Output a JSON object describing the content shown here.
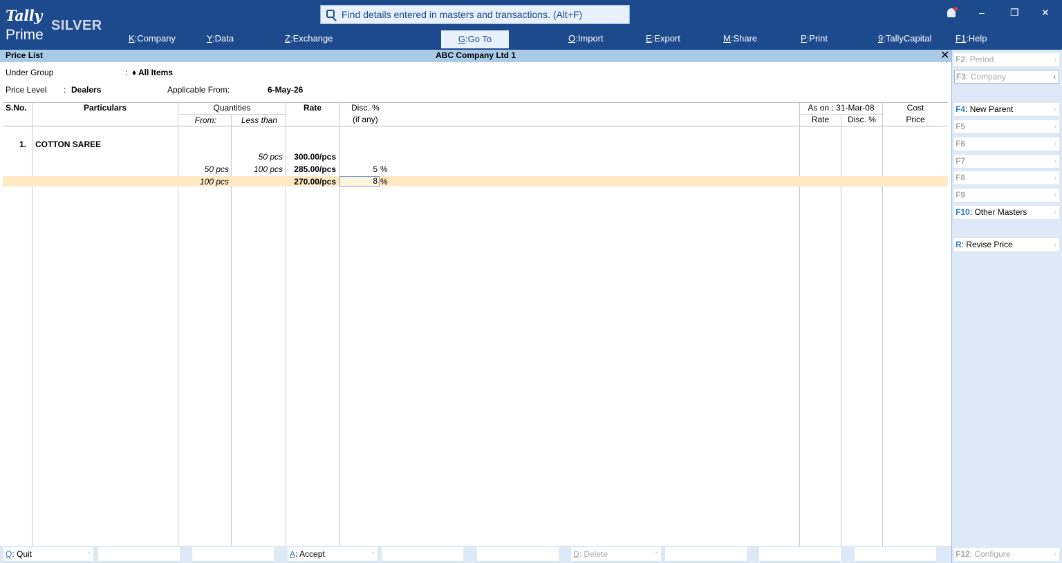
{
  "app": {
    "logo_top": "Tally",
    "logo_bottom": "Prime",
    "edition": "SILVER"
  },
  "search": {
    "text": "Find details entered in masters and transactions. (Alt+F)"
  },
  "window": {
    "minimize": "–",
    "restore": "❐",
    "close": "✕"
  },
  "menu": [
    {
      "key": "K",
      "label": "Company"
    },
    {
      "key": "Y",
      "label": "Data"
    },
    {
      "key": "Z",
      "label": "Exchange"
    },
    {
      "key": "G",
      "label": "Go To"
    },
    {
      "key": "O",
      "label": "Import"
    },
    {
      "key": "E",
      "label": "Export"
    },
    {
      "key": "M",
      "label": "Share"
    },
    {
      "key": "P",
      "label": "Print"
    },
    {
      "key": "9",
      "label": "TallyCapital"
    },
    {
      "key": "F1",
      "label": "Help"
    }
  ],
  "titlebar": {
    "screen": "Price List",
    "company": "ABC Company Ltd 1",
    "close": "✕"
  },
  "header": {
    "under_group_label": "Under Group",
    "under_group_sep": ":",
    "under_group_value": "♦ All Items",
    "price_level_label": "Price Level",
    "price_level_sep": ":",
    "price_level_value": "Dealers",
    "applicable_from_label": "Applicable From:",
    "applicable_from_value": "6-May-26"
  },
  "columns": {
    "sno": "S.No.",
    "particulars": "Particulars",
    "quantities": "Quantities",
    "from": "From:",
    "less_than": "Less than",
    "rate": "Rate",
    "disc": "Disc. %",
    "if_any": "(if any)",
    "as_on": "As on : 31-Mar-08",
    "as_on_rate": "Rate",
    "as_on_disc": "Disc. %",
    "cost": "Cost",
    "cost_price": "Price"
  },
  "item": {
    "sno": "1.",
    "name": "COTTON SAREE"
  },
  "slabs": [
    {
      "from": "",
      "less_than": "50 pcs",
      "rate": "300.00/pcs",
      "disc": "",
      "disc_unit": ""
    },
    {
      "from": "50 pcs",
      "less_than": "100 pcs",
      "rate": "285.00/pcs",
      "disc": "5",
      "disc_unit": "%"
    },
    {
      "from": "100 pcs",
      "less_than": "",
      "rate": "270.00/pcs",
      "disc": "8",
      "disc_unit": "%"
    }
  ],
  "right_panel": [
    {
      "key": "F2",
      "label": "Period",
      "enabled": false
    },
    {
      "key": "F3",
      "label": "Company",
      "enabled": false
    },
    {
      "key": "F4",
      "label": "New Parent",
      "enabled": true
    },
    {
      "key": "F5",
      "label": "",
      "enabled": false
    },
    {
      "key": "F6",
      "label": "",
      "enabled": false
    },
    {
      "key": "F7",
      "label": "",
      "enabled": false
    },
    {
      "key": "F8",
      "label": "",
      "enabled": false
    },
    {
      "key": "F9",
      "label": "",
      "enabled": false
    },
    {
      "key": "F10",
      "label": "Other Masters",
      "enabled": true
    },
    {
      "key": "R",
      "label": "Revise Price",
      "enabled": true
    },
    {
      "key": "F12",
      "label": "Configure",
      "enabled": false
    }
  ],
  "bottom_bar": [
    {
      "key": "Q",
      "label": "Quit",
      "enabled": true
    },
    {
      "key": "A",
      "label": "Accept",
      "enabled": true
    },
    {
      "key": "D",
      "label": "Delete",
      "enabled": false
    }
  ],
  "colors": {
    "topbar": "#1d4a8c",
    "titlebar": "#a9cbe8",
    "highlight_row": "#fde9c4",
    "panel": "#dde9f7",
    "key_blue": "#2a7bd4"
  }
}
